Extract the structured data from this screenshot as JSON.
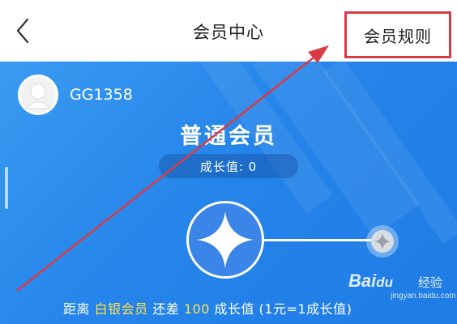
{
  "header": {
    "title": "会员中心",
    "rules_label": "会员规则"
  },
  "user": {
    "name": "GG1358"
  },
  "membership": {
    "level": "普通会员",
    "growth_label": "成长值: 0"
  },
  "upgrade_hint": {
    "prefix": "距离",
    "next_level": "白银会员",
    "middle": "还差",
    "points": "100",
    "suffix": "成长值 (1元=1成长值)"
  },
  "watermark": {
    "brand": "Bai",
    "paw": "du",
    "jingyan": "经验",
    "url": "jingyan.baidu.com"
  },
  "colors": {
    "accent": "#2585ea",
    "highlight": "#ffe14d",
    "annotation": "#d93b45"
  },
  "icons": {
    "back": "chevron-left-icon",
    "avatar": "default-avatar-icon",
    "level_badge": "four-point-star-icon",
    "next_badge": "four-point-star-icon"
  }
}
